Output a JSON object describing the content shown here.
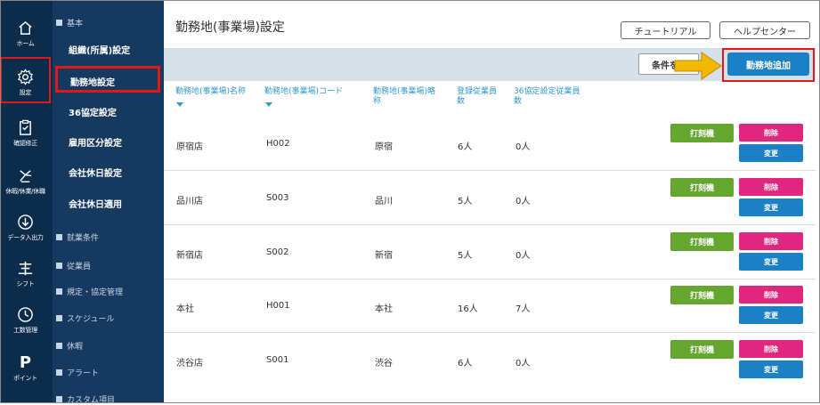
{
  "rail": {
    "items": [
      {
        "label": "ホーム",
        "icon": "home-icon"
      },
      {
        "label": "設定",
        "icon": "gear-icon"
      },
      {
        "label": "確認修正",
        "icon": "clipboard-icon"
      },
      {
        "label": "休暇/休業/休職",
        "icon": "palm-icon"
      },
      {
        "label": "データ入出力",
        "icon": "download-circle-icon"
      },
      {
        "label": "シフト",
        "icon": "shift-icon"
      },
      {
        "label": "工数管理",
        "icon": "clock-icon"
      },
      {
        "label": "ポイント",
        "glyph": "P"
      }
    ]
  },
  "submenu": {
    "section_basic": "基本",
    "items": [
      "組織(所属)設定",
      "勤務地設定",
      "36協定設定",
      "雇用区分設定",
      "会社休日設定",
      "会社休日適用"
    ],
    "sections": [
      "就業条件",
      "従業員",
      "規定・協定管理",
      "スケジュール",
      "休暇",
      "アラート",
      "カスタム項目"
    ]
  },
  "header": {
    "title": "勤務地(事業場)設定",
    "tutorial": "チュートリアル",
    "help": "ヘルプセンター"
  },
  "toolbar": {
    "filter": "条件を",
    "add": "勤務地追加"
  },
  "table": {
    "headers": [
      "勤務地(事業場)名称",
      "勤務地(事業場)コード",
      "勤務地(事業場)略称",
      "登録従業員数",
      "36協定設定従業員数"
    ],
    "header_lines": [
      [
        "勤務地(事業場)名称"
      ],
      [
        "勤務地(事業場)コード"
      ],
      [
        "勤務地(事業場)略",
        "称"
      ],
      [
        "登録従業員",
        "数"
      ],
      [
        "36協定設定従業員",
        "数"
      ]
    ],
    "rows": [
      {
        "name": "原宿店",
        "code": "H002",
        "short": "原宿",
        "employees": "6人",
        "agreement": "0人"
      },
      {
        "name": "品川店",
        "code": "S003",
        "short": "品川",
        "employees": "5人",
        "agreement": "0人"
      },
      {
        "name": "新宿店",
        "code": "S002",
        "short": "新宿",
        "employees": "5人",
        "agreement": "0人"
      },
      {
        "name": "本社",
        "code": "H001",
        "short": "本社",
        "employees": "16人",
        "agreement": "7人"
      },
      {
        "name": "渋谷店",
        "code": "S001",
        "short": "渋谷",
        "employees": "6人",
        "agreement": "0人"
      }
    ],
    "buttons": {
      "clock": "打刻機",
      "delete": "削除",
      "edit": "変更"
    }
  },
  "colors": {
    "rail": "#0c2c4c",
    "submenu": "#16395f",
    "accent_blue": "#1b80c5",
    "green": "#65a72e",
    "pink": "#e0267e",
    "highlight": "#e01818",
    "arrow": "#f5b800"
  }
}
